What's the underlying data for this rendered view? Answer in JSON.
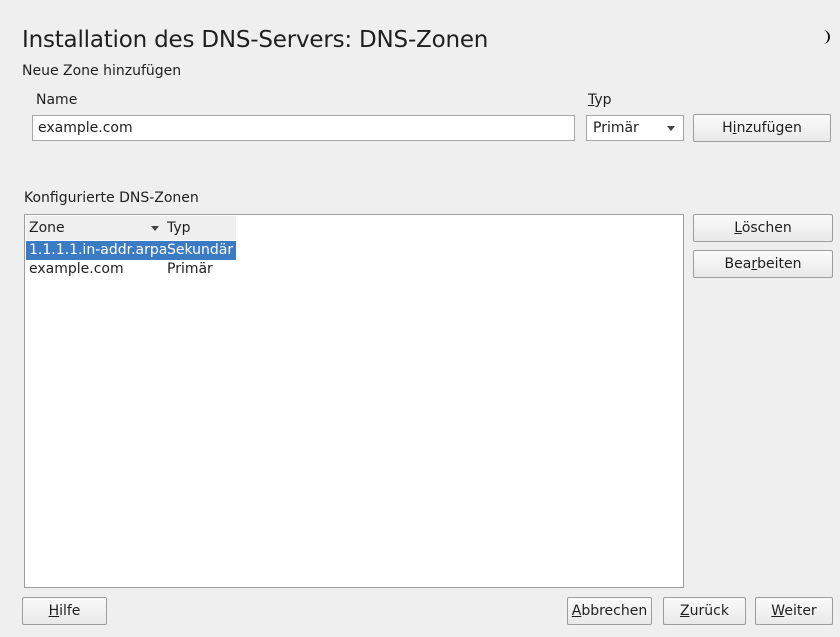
{
  "window": {
    "title": "Installation des DNS-Servers: DNS-Zonen"
  },
  "add_zone": {
    "section_label": "Neue Zone hinzufügen",
    "name_label": "Name",
    "name_value": "example.com",
    "type_label_prefix": "",
    "type_label_mnemonic": "T",
    "type_label_rest": "yp",
    "type_value": "Primär",
    "add_button": {
      "pre": "H",
      "mnemonic": "i",
      "post": "nzufügen"
    }
  },
  "zones": {
    "section_label": "Konfigurierte DNS-Zonen",
    "columns": [
      "Zone",
      "Typ"
    ],
    "rows": [
      {
        "zone": "1.1.1.1.in-addr.arpa",
        "type": "Sekundär",
        "selected": true
      },
      {
        "zone": "example.com",
        "type": "Primär",
        "selected": false
      }
    ],
    "delete_button": {
      "pre": "",
      "mnemonic": "L",
      "post": "öschen"
    },
    "edit_button": {
      "pre": "Bea",
      "mnemonic": "r",
      "post": "beiten"
    }
  },
  "footer": {
    "help_button": {
      "pre": "",
      "mnemonic": "H",
      "post": "ilfe"
    },
    "cancel_button": {
      "pre": "",
      "mnemonic": "A",
      "post": "bbrechen"
    },
    "back_button": {
      "pre": "",
      "mnemonic": "Z",
      "post": "urück"
    },
    "next_button": {
      "pre": "",
      "mnemonic": "W",
      "post": "eiter"
    }
  },
  "icons": {
    "theme": "moon-icon"
  },
  "colors": {
    "selection": "#3b7bc4",
    "background": "#efefef"
  }
}
